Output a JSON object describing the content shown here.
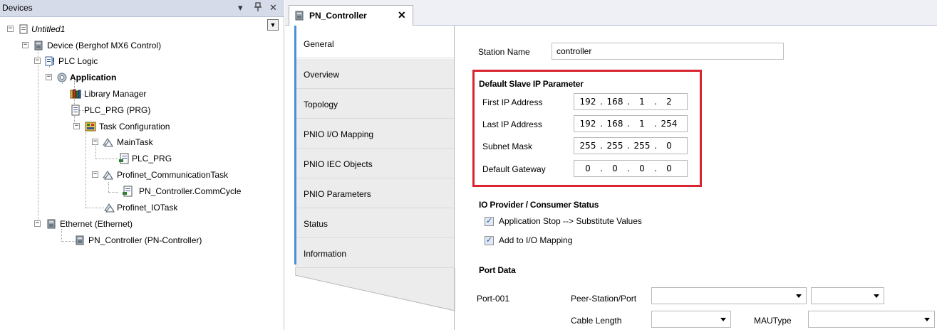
{
  "devices_pane": {
    "title": "Devices",
    "pin_glyph": "↕",
    "close_glyph": "✕",
    "menu_glyph": "▾",
    "dropdown_glyph": "▼",
    "tree": [
      {
        "label": "Untitled1",
        "italic": true,
        "icon": "project-icon"
      },
      {
        "label": "Device (Berghof MX6 Control)",
        "icon": "device-icon"
      },
      {
        "label": "PLC Logic",
        "icon": "plc-logic-icon"
      },
      {
        "label": "Application",
        "bold": true,
        "icon": "application-gear-icon"
      },
      {
        "label": "Library Manager",
        "icon": "library-manager-icon"
      },
      {
        "label": "PLC_PRG (PRG)",
        "icon": "program-icon"
      },
      {
        "label": "Task Configuration",
        "icon": "task-configuration-icon"
      },
      {
        "label": "MainTask",
        "icon": "task-icon"
      },
      {
        "label": "PLC_PRG",
        "icon": "program-call-icon"
      },
      {
        "label": "Profinet_CommunicationTask",
        "icon": "task-icon"
      },
      {
        "label": "PN_Controller.CommCycle",
        "icon": "program-call-icon"
      },
      {
        "label": "Profinet_IOTask",
        "icon": "task-icon"
      },
      {
        "label": "Ethernet (Ethernet)",
        "icon": "ethernet-device-icon"
      },
      {
        "label": "PN_Controller (PN-Controller)",
        "icon": "pn-controller-icon"
      }
    ]
  },
  "editor": {
    "tab_label": "PN_Controller",
    "tab_close": "✕",
    "side_tabs": [
      "General",
      "Overview",
      "Topology",
      "PNIO I/O Mapping",
      "PNIO IEC Objects",
      "PNIO Parameters",
      "Status",
      "Information"
    ],
    "active_side_tab": "General",
    "station_name_label": "Station Name",
    "station_name_value": "controller",
    "default_slave_ip": {
      "title": "Default Slave IP Parameter",
      "rows": [
        {
          "label": "First IP Address",
          "octets": [
            "192",
            "168",
            "1",
            "2"
          ]
        },
        {
          "label": "Last IP Address",
          "octets": [
            "192",
            "168",
            "1",
            "254"
          ]
        },
        {
          "label": "Subnet Mask",
          "octets": [
            "255",
            "255",
            "255",
            "0"
          ]
        },
        {
          "label": "Default Gateway",
          "octets": [
            "0",
            "0",
            "0",
            "0"
          ]
        }
      ],
      "highlight_color": "#d9252f"
    },
    "io_status": {
      "title": "IO Provider / Consumer Status",
      "options": [
        {
          "label": "Application Stop --> Substitute Values",
          "checked": true
        },
        {
          "label": "Add to I/O Mapping",
          "checked": true
        }
      ]
    },
    "port_data": {
      "title": "Port Data",
      "port_label": "Port-001",
      "peer_label": "Peer-Station/Port",
      "cable_length_label": "Cable Length",
      "mau_type_label": "MAUType"
    }
  },
  "colors": {
    "header_bg": "#d6dbe9",
    "accent": "#4a90d9",
    "highlight": "#d9252f"
  }
}
